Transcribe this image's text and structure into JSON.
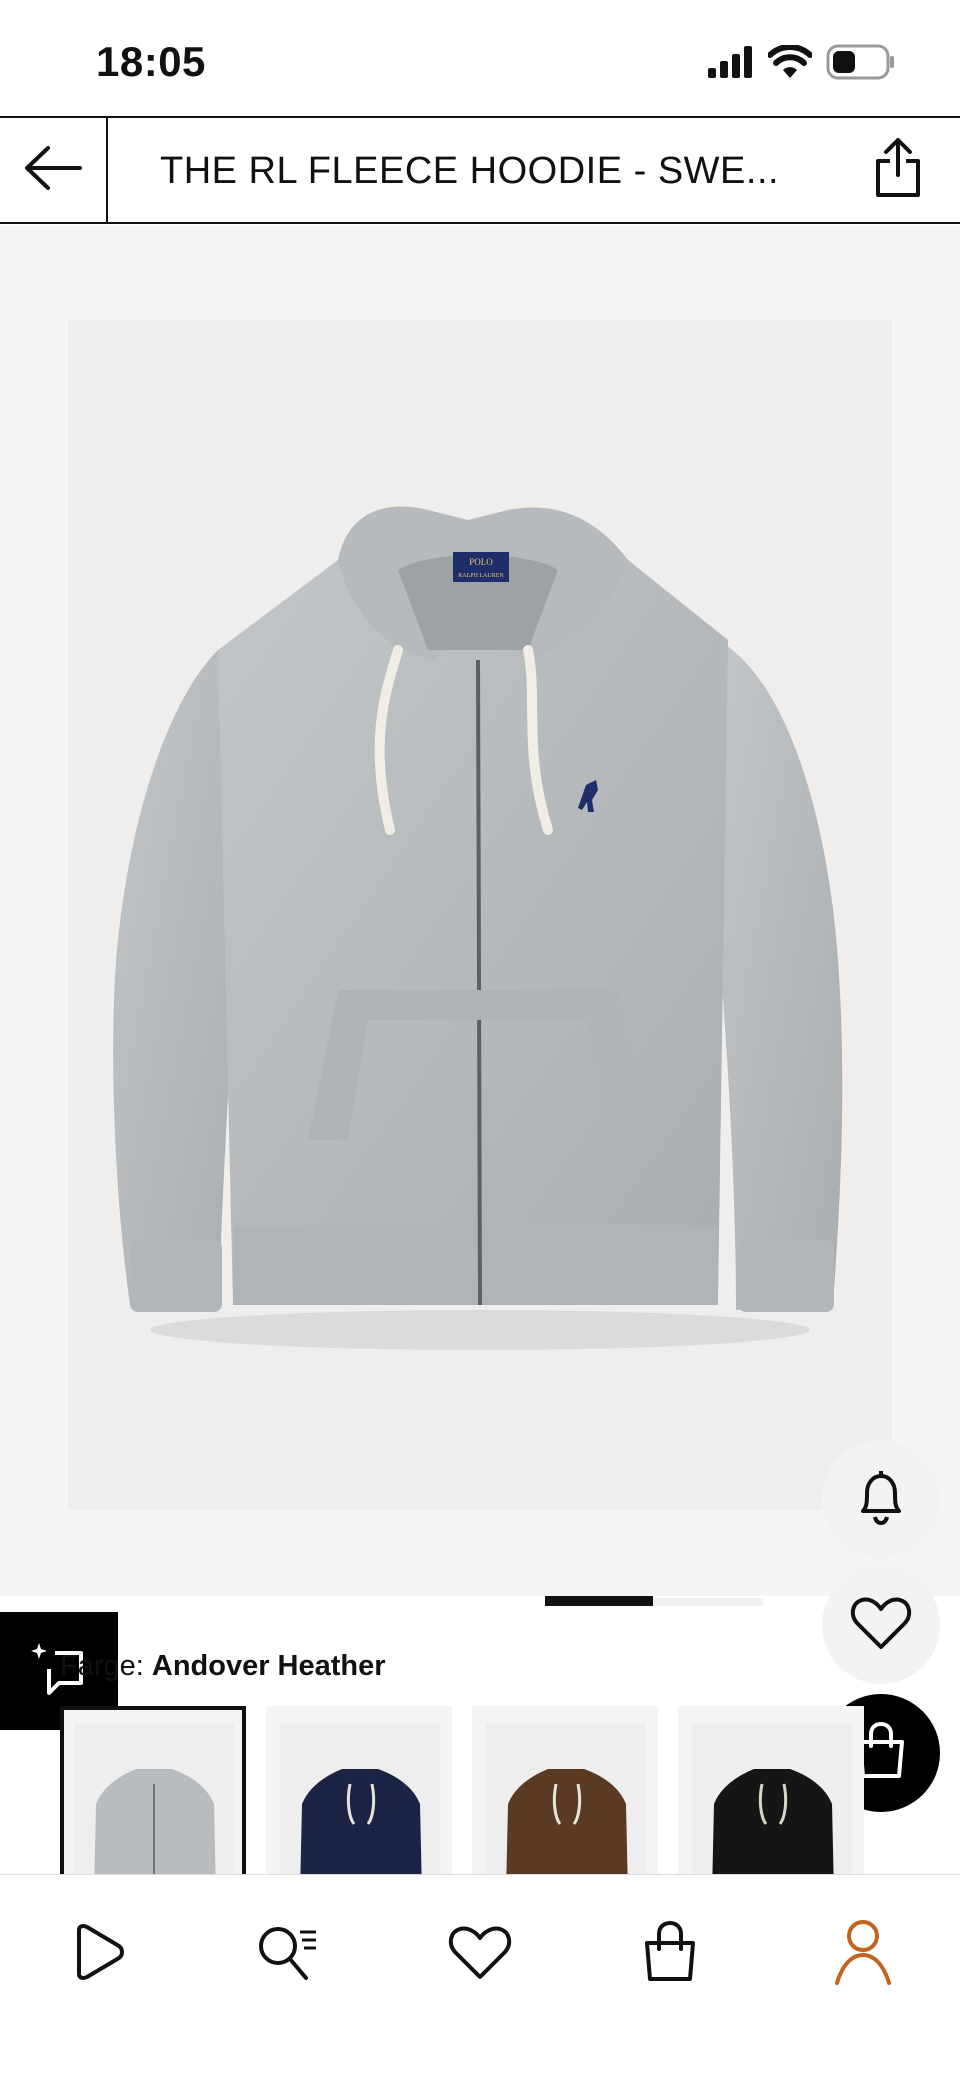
{
  "status_bar": {
    "time": "18:05"
  },
  "header": {
    "title": "THE RL FLEECE HOODIE - SWE..."
  },
  "product": {
    "image_icon": "hoodie-photo",
    "badge_top": "POLO",
    "badge_bottom": "RALPH LAUREN"
  },
  "color": {
    "label": "Farge: ",
    "selected_name": "Andover Heather",
    "swatches": [
      {
        "name": "Andover Heather",
        "hex": "#b9bcbe",
        "selected": true
      },
      {
        "name": "Navy",
        "hex": "#1c2445",
        "selected": false
      },
      {
        "name": "Brown",
        "hex": "#5a3a22",
        "selected": false
      },
      {
        "name": "Black",
        "hex": "#151515",
        "selected": false
      }
    ]
  },
  "actions": {
    "notify_icon": "bell-icon",
    "wishlist_icon": "heart-icon",
    "bag_icon": "shopping-bag-icon",
    "similar_icon": "sparkle-chat-icon"
  },
  "tab_bar": {
    "accent": "#c4621f",
    "tabs": [
      {
        "icon": "play-icon",
        "active": false
      },
      {
        "icon": "search-list-icon",
        "active": false
      },
      {
        "icon": "heart-icon",
        "active": false
      },
      {
        "icon": "bag-icon",
        "active": false
      },
      {
        "icon": "profile-icon",
        "active": true
      }
    ]
  }
}
